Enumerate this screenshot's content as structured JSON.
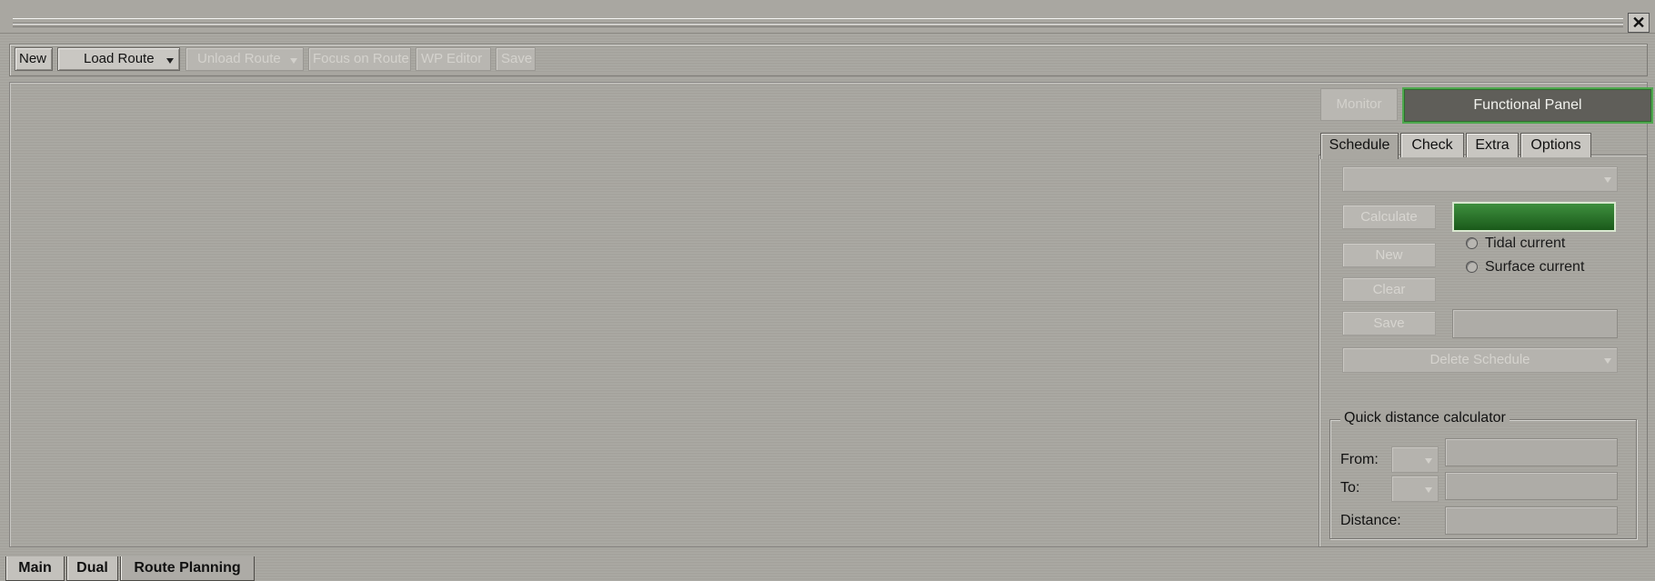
{
  "titlebar": {
    "close_glyph": "✕"
  },
  "toolbar": {
    "new_label": "New",
    "load_route_label": "Load Route",
    "unload_route_label": "Unload Route",
    "focus_on_route_label": "Focus on Route",
    "wp_editor_label": "WP Editor",
    "save_label": "Save"
  },
  "right_header": {
    "monitor_label": "Monitor",
    "functional_panel_label": "Functional Panel"
  },
  "panel_tabs": [
    {
      "label": "Schedule",
      "active": true
    },
    {
      "label": "Check",
      "active": false
    },
    {
      "label": "Extra",
      "active": false
    },
    {
      "label": "Options",
      "active": false
    }
  ],
  "schedule": {
    "schedule_select_value": "",
    "calculate_label": "Calculate",
    "new_label": "New",
    "clear_label": "Clear",
    "save_label": "Save",
    "save_name_value": "",
    "current_options": [
      "Tidal current",
      "Surface current"
    ],
    "delete_schedule_label": "Delete Schedule",
    "status_color": "#2f7f2f"
  },
  "quick_distance": {
    "title": "Quick distance calculator",
    "from_label": "From:",
    "to_label": "To:",
    "distance_label": "Distance:",
    "from_value": "",
    "to_value": "",
    "distance_value": ""
  },
  "bottom_tabs": [
    {
      "label": "Main",
      "active": false
    },
    {
      "label": "Dual",
      "active": false
    },
    {
      "label": "Route Planning",
      "active": true
    }
  ],
  "colors": {
    "background": "#a7a59f",
    "accent_green": "#4ea84e",
    "functional_panel_bg": "#5f5e59"
  }
}
